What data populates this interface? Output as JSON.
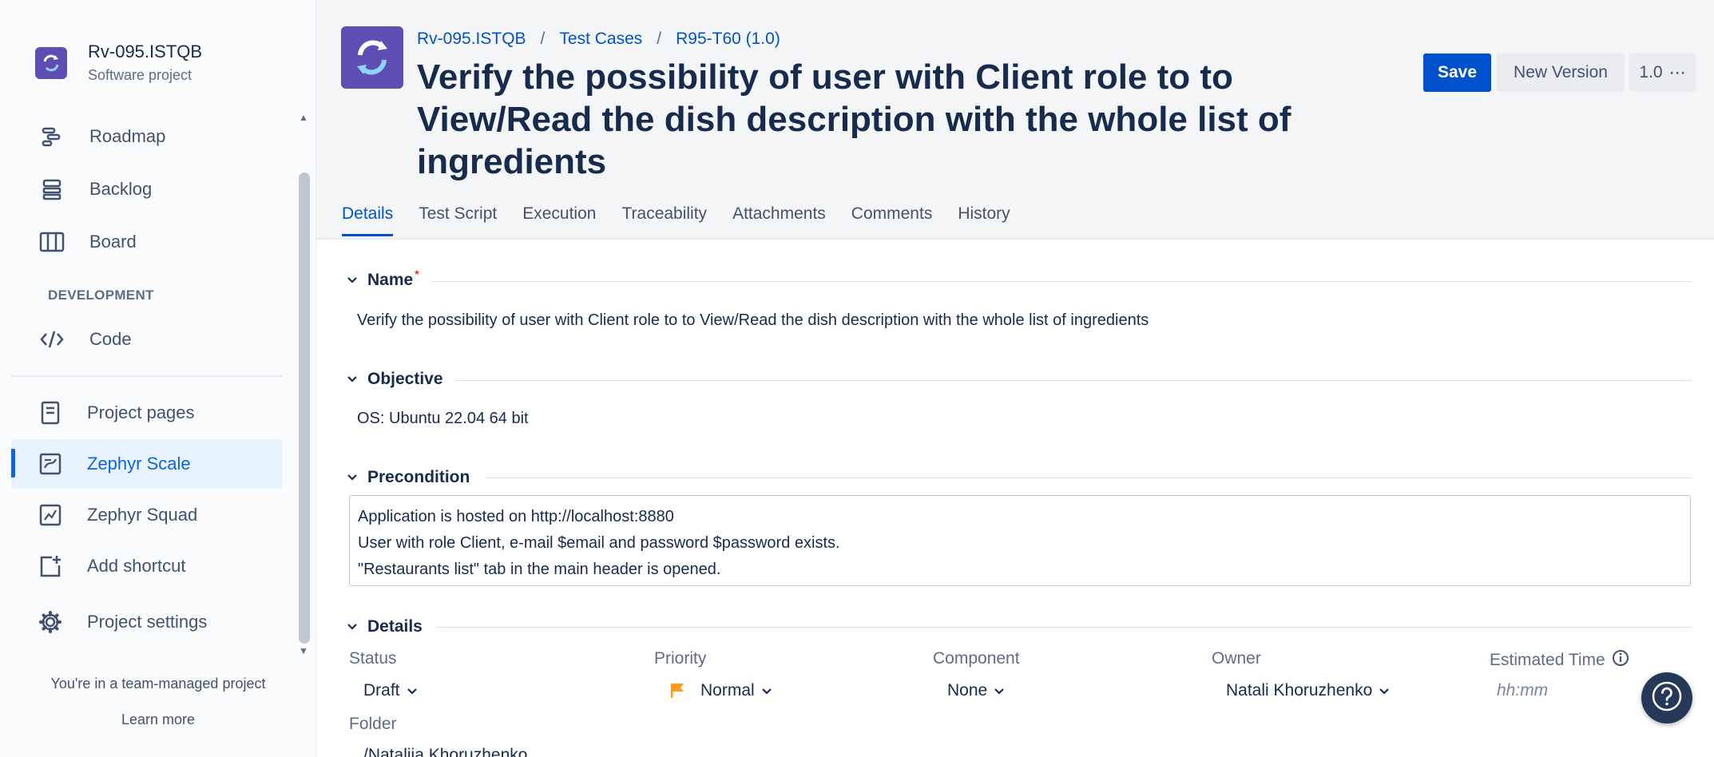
{
  "project": {
    "name": "Rv-095.ISTQB",
    "type": "Software project"
  },
  "sidebar": {
    "items": [
      {
        "label": "Roadmap",
        "icon": "roadmap-icon"
      },
      {
        "label": "Backlog",
        "icon": "backlog-icon"
      },
      {
        "label": "Board",
        "icon": "board-icon"
      }
    ],
    "section_development": "DEVELOPMENT",
    "dev_items": [
      {
        "label": "Code",
        "icon": "code-icon"
      }
    ],
    "app_items": [
      {
        "label": "Project pages",
        "icon": "page-icon"
      },
      {
        "label": "Zephyr Scale",
        "icon": "zephyr-scale-icon",
        "active": true
      },
      {
        "label": "Zephyr Squad",
        "icon": "zephyr-squad-icon"
      },
      {
        "label": "Add shortcut",
        "icon": "add-shortcut-icon"
      },
      {
        "label": "Project settings",
        "icon": "gear-icon"
      }
    ],
    "footer_text": "You're in a team-managed project",
    "footer_link": "Learn more"
  },
  "breadcrumb": {
    "project": "Rv-095.ISTQB",
    "section": "Test Cases",
    "item": "R95-T60 (1.0)",
    "separator": "/"
  },
  "page_title": "Verify the possibility of user with Client role to to View/Read the dish description with the whole list of ingredients",
  "toolbar": {
    "save_label": "Save",
    "new_version_label": "New Version",
    "version_label": "1.0",
    "more_label": "⋯"
  },
  "tabs": [
    {
      "label": "Details",
      "active": true
    },
    {
      "label": "Test Script"
    },
    {
      "label": "Execution"
    },
    {
      "label": "Traceability"
    },
    {
      "label": "Attachments"
    },
    {
      "label": "Comments"
    },
    {
      "label": "History"
    }
  ],
  "sections": {
    "name": {
      "title": "Name",
      "required_mark": "*",
      "value": "Verify the possibility of user with Client role to to View/Read the dish description with the whole list of ingredients"
    },
    "objective": {
      "title": "Objective",
      "value": "OS: Ubuntu 22.04 64 bit"
    },
    "precondition": {
      "title": "Precondition",
      "lines": [
        "Application is hosted on http://localhost:8880",
        "User with role Client, e-mail $email and password $password exists.",
        "\"Restaurants list\" tab in the main header is opened."
      ]
    },
    "details": {
      "title": "Details",
      "status_label": "Status",
      "status_value": "Draft",
      "priority_label": "Priority",
      "priority_value": "Normal",
      "priority_color": "#ff991f",
      "component_label": "Component",
      "component_value": "None",
      "owner_label": "Owner",
      "owner_value": "Natali Khoruzhenko",
      "estimated_label": "Estimated Time",
      "estimated_placeholder": "hh:mm",
      "folder_label": "Folder",
      "folder_value": "/Nataliia Khoruzhenko"
    }
  },
  "colors": {
    "accent": "#0052cc",
    "project_icon": "#5e4db2",
    "help_button": "#253858"
  }
}
